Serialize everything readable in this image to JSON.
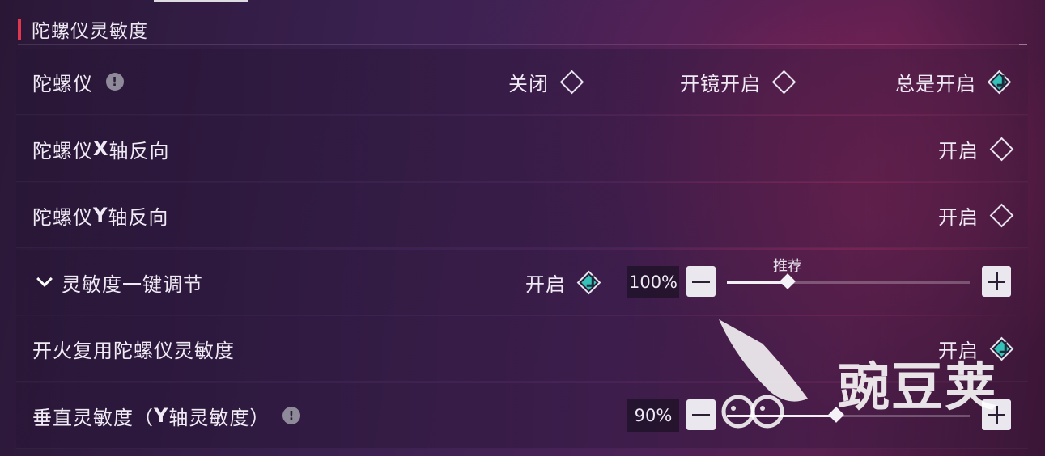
{
  "section": {
    "title": "陀螺仪灵敏度"
  },
  "rows": {
    "gyro": {
      "label": "陀螺仪",
      "options": [
        {
          "label": "关闭",
          "selected": false
        },
        {
          "label": "开镜开启",
          "selected": false
        },
        {
          "label": "总是开启",
          "selected": true
        }
      ]
    },
    "invert_x": {
      "label_pre": "陀螺仪",
      "label_bold": "X",
      "label_post": "轴反向",
      "toggle_label": "开启",
      "enabled": false
    },
    "invert_y": {
      "label_pre": "陀螺仪",
      "label_bold": "Y",
      "label_post": "轴反向",
      "toggle_label": "开启",
      "enabled": false
    },
    "one_key": {
      "label": "灵敏度一键调节",
      "toggle_label": "开启",
      "enabled": true,
      "value_text": "100%",
      "value": 100,
      "slider_min": 0,
      "slider_max": 400,
      "marker_label": "推荐"
    },
    "fire_reuse": {
      "label": "开火复用陀螺仪灵敏度",
      "toggle_label": "开启",
      "enabled": true
    },
    "vertical": {
      "label_pre": "垂直灵敏度（",
      "label_bold": "Y",
      "label_post": "轴灵敏度）",
      "value_text": "90%",
      "value": 90,
      "slider_min": 0,
      "slider_max": 200
    }
  },
  "info_icon_glyph": "!",
  "watermark": {
    "text": "豌豆荚"
  },
  "colors": {
    "accent_bar": "#e0364e",
    "check_teal": "#35c2b8"
  }
}
